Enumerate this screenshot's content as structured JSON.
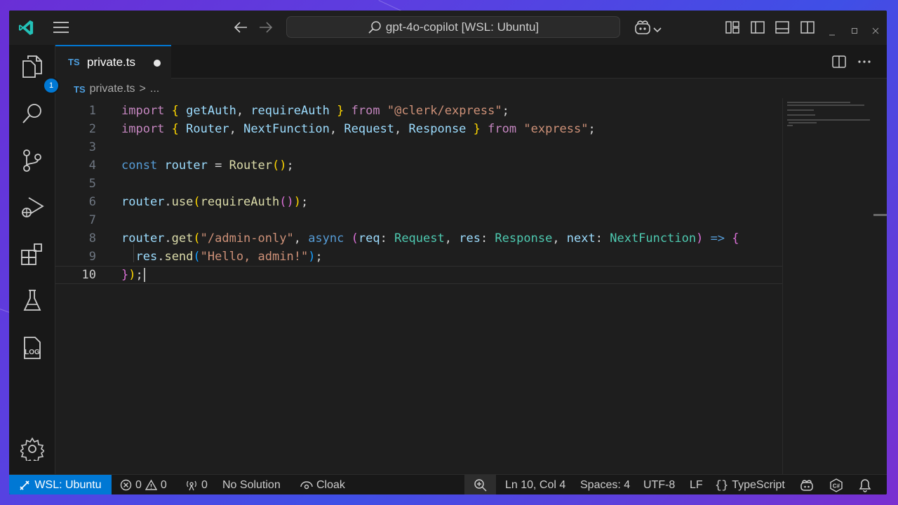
{
  "window": {
    "title": "gpt-4o-copilot [WSL: Ubuntu]"
  },
  "activity_bar": {
    "explorer_badge": "1",
    "items": [
      "explorer",
      "search",
      "source-control",
      "run-and-debug",
      "extensions",
      "testing",
      "output-log",
      "manage"
    ],
    "log_label": "LOG"
  },
  "tabs": [
    {
      "lang_badge": "TS",
      "label": "private.ts",
      "dirty": true
    }
  ],
  "breadcrumb": {
    "lang_badge": "TS",
    "file": "private.ts",
    "separator": ">",
    "ellipsis": "..."
  },
  "editor": {
    "language": "TypeScript",
    "active_line": 10,
    "lines": [
      "import { getAuth, requireAuth } from \"@clerk/express\";",
      "import { Router, NextFunction, Request, Response } from \"express\";",
      "",
      "const router = Router();",
      "",
      "router.use(requireAuth());",
      "",
      "router.get(\"/admin-only\", async (req: Request, res: Response, next: NextFunction) => {",
      "  res.send(\"Hello, admin!\");",
      "});"
    ],
    "line_numbers": [
      "1",
      "2",
      "3",
      "4",
      "5",
      "6",
      "7",
      "8",
      "9",
      "10"
    ]
  },
  "status_bar": {
    "remote": "WSL: Ubuntu",
    "errors": "0",
    "warnings": "0",
    "ports": "0",
    "solution": "No Solution",
    "cloak": "Cloak",
    "cursor": "Ln 10, Col 4",
    "spaces": "Spaces: 4",
    "encoding": "UTF-8",
    "eol": "LF",
    "language_braces": "{}",
    "language": "TypeScript"
  },
  "colors": {
    "accent": "#0078d4",
    "editor_bg": "#1e1e1e",
    "chrome_bg": "#181818",
    "logo": "#23c1b8"
  }
}
